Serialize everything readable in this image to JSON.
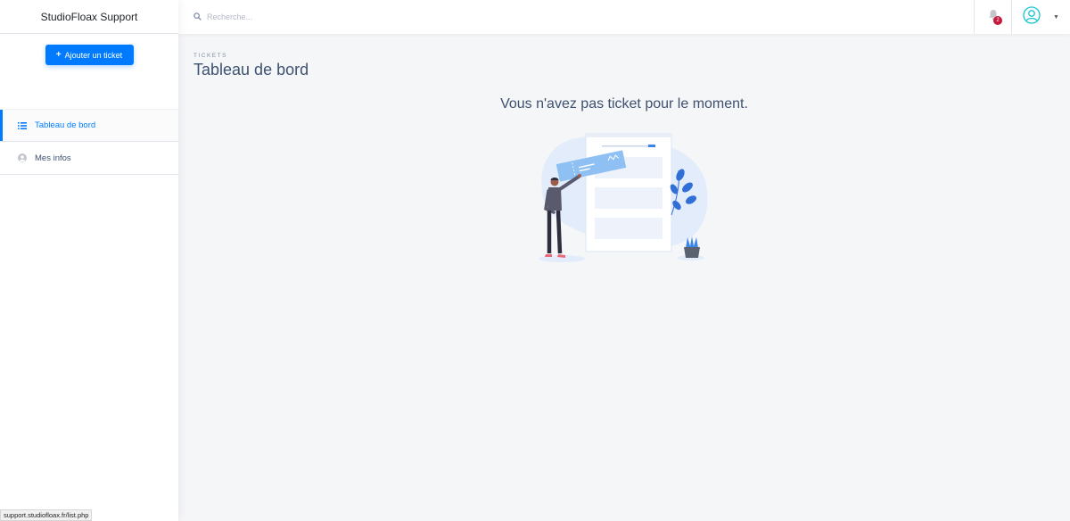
{
  "sidebar": {
    "brand": "StudioFloax Support",
    "add_button": {
      "icon": "plus-icon",
      "label": "Ajouter un ticket"
    },
    "items": [
      {
        "label": "Tableau de bord",
        "icon": "list-icon",
        "active": true
      },
      {
        "label": "Mes infos",
        "icon": "user-circle-icon",
        "active": false
      }
    ]
  },
  "topbar": {
    "search": {
      "placeholder": "Recherche...",
      "icon": "search-icon"
    },
    "notifications": {
      "icon": "bell-icon",
      "count": "2"
    },
    "user": {
      "icon": "user-circle-icon",
      "caret_icon": "caret-down-icon"
    }
  },
  "main": {
    "subtitle": "Tickets",
    "title": "Tableau de bord",
    "empty_message": "Vous n'avez pas ticket pour le moment."
  },
  "status_bar": {
    "url": "support.studiofloax.fr/list.php"
  },
  "colors": {
    "primary": "#007bff",
    "danger": "#c4183c",
    "text": "#3d5170",
    "bg": "#f5f6f8"
  }
}
